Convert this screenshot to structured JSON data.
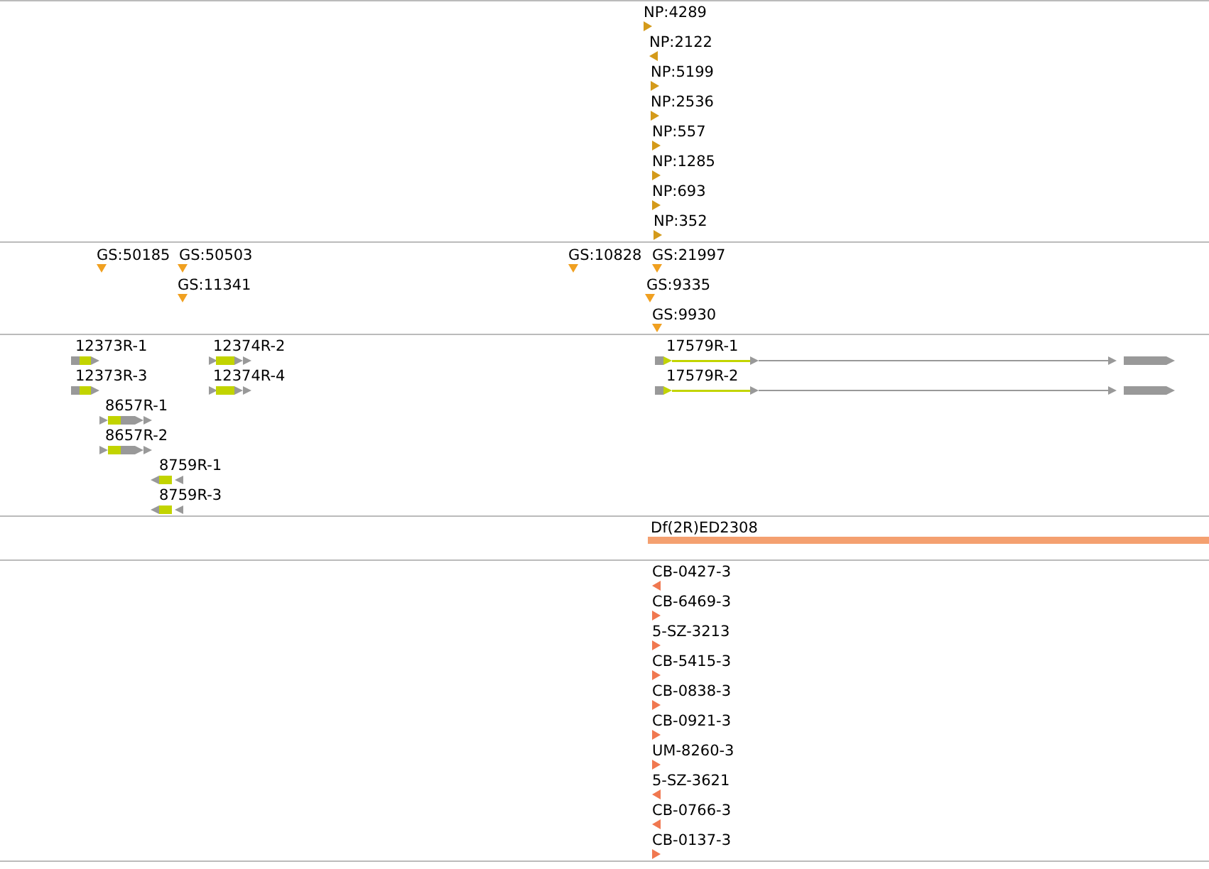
{
  "tracks": [
    {
      "kind": "points",
      "color": "#d49a1a",
      "features": [
        {
          "label": "NP:4289",
          "reverse": false
        },
        {
          "label": "NP:2122",
          "reverse": true
        },
        {
          "label": "NP:5199",
          "reverse": false
        },
        {
          "label": "NP:2536",
          "reverse": false
        },
        {
          "label": "NP:557",
          "reverse": false
        },
        {
          "label": "NP:1285",
          "reverse": false
        },
        {
          "label": "NP:693",
          "reverse": false
        },
        {
          "label": "NP:352",
          "reverse": false
        }
      ]
    },
    {
      "kind": "sites",
      "color": "#f0a020",
      "features": [
        {
          "label": "GS:50185"
        },
        {
          "label": "GS:50503"
        },
        {
          "label": "GS:11341"
        },
        {
          "label": "GS:10828"
        },
        {
          "label": "GS:21997"
        },
        {
          "label": "GS:9335"
        },
        {
          "label": "GS:9930"
        }
      ]
    },
    {
      "kind": "genes",
      "features": [
        {
          "label": "12373R-1",
          "reverse": false
        },
        {
          "label": "12374R-2",
          "reverse": false
        },
        {
          "label": "12373R-3",
          "reverse": false
        },
        {
          "label": "12374R-4",
          "reverse": false
        },
        {
          "label": "8657R-1",
          "reverse": false
        },
        {
          "label": "8657R-2",
          "reverse": false
        },
        {
          "label": "8759R-1",
          "reverse": true
        },
        {
          "label": "8759R-3",
          "reverse": true
        },
        {
          "label": "17579R-1",
          "reverse": false
        },
        {
          "label": "17579R-2",
          "reverse": false
        }
      ]
    },
    {
      "kind": "span",
      "color": "#f4a070",
      "features": [
        {
          "label": "Df(2R)ED2308"
        }
      ]
    },
    {
      "kind": "points",
      "color": "#f07850",
      "features": [
        {
          "label": "CB-0427-3",
          "reverse": true
        },
        {
          "label": "CB-6469-3",
          "reverse": false
        },
        {
          "label": "5-SZ-3213",
          "reverse": false
        },
        {
          "label": "CB-5415-3",
          "reverse": false
        },
        {
          "label": "CB-0838-3",
          "reverse": false
        },
        {
          "label": "CB-0921-3",
          "reverse": false
        },
        {
          "label": "UM-8260-3",
          "reverse": false
        },
        {
          "label": "5-SZ-3621",
          "reverse": true
        },
        {
          "label": "CB-0766-3",
          "reverse": true
        },
        {
          "label": "CB-0137-3",
          "reverse": false
        }
      ]
    }
  ]
}
